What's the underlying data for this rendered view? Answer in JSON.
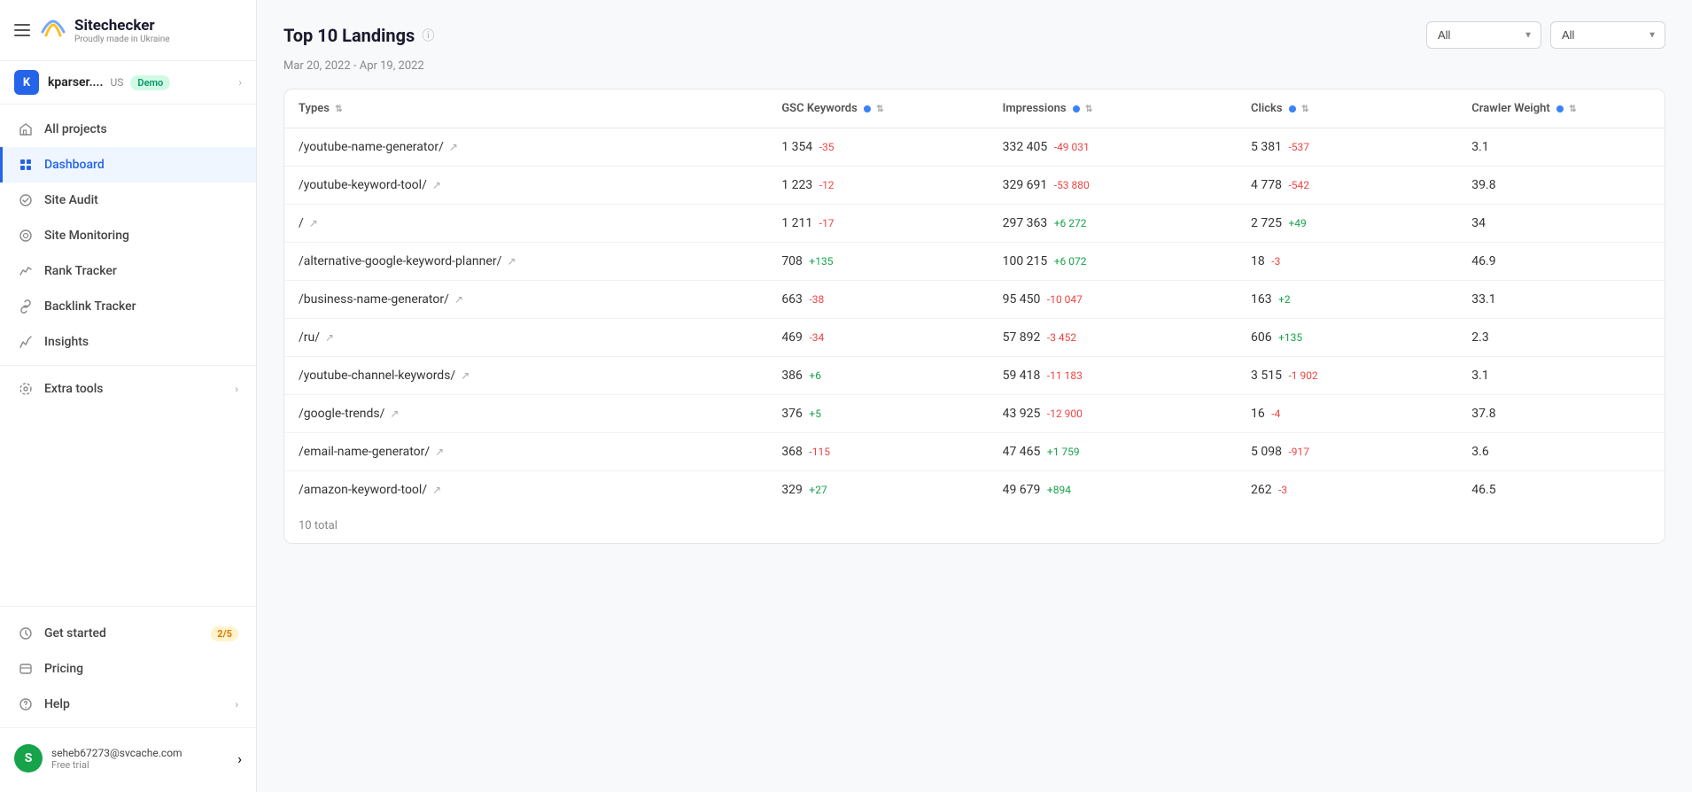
{
  "sidebar": {
    "logo": {
      "name": "Sitechecker",
      "subtitle": "Proudly made in Ukraine"
    },
    "project": {
      "initial": "K",
      "name": "kparser....",
      "country": "US",
      "badge": "Demo"
    },
    "nav": [
      {
        "id": "all-projects",
        "label": "All projects",
        "icon": "home"
      },
      {
        "id": "dashboard",
        "label": "Dashboard",
        "icon": "dashboard",
        "active": true
      },
      {
        "id": "site-audit",
        "label": "Site Audit",
        "icon": "audit"
      },
      {
        "id": "site-monitoring",
        "label": "Site Monitoring",
        "icon": "monitoring"
      },
      {
        "id": "rank-tracker",
        "label": "Rank Tracker",
        "icon": "rank"
      },
      {
        "id": "backlink-tracker",
        "label": "Backlink Tracker",
        "icon": "backlink"
      },
      {
        "id": "insights",
        "label": "Insights",
        "icon": "insights"
      }
    ],
    "extra_tools": {
      "label": "Extra tools",
      "has_chevron": true
    },
    "get_started": {
      "label": "Get started",
      "badge": "2/5"
    },
    "pricing": {
      "label": "Pricing"
    },
    "help": {
      "label": "Help",
      "has_chevron": true
    },
    "user": {
      "email": "seheb67273@svcache.com",
      "plan": "Free trial",
      "initial": "S"
    }
  },
  "main": {
    "title": "Top 10 Landings",
    "date_range": "Mar 20, 2022 - Apr 19, 2022",
    "filters": [
      {
        "id": "filter1",
        "value": "All",
        "options": [
          "All"
        ]
      },
      {
        "id": "filter2",
        "value": "All",
        "options": [
          "All"
        ]
      }
    ],
    "table": {
      "columns": [
        {
          "id": "types",
          "label": "Types"
        },
        {
          "id": "gsc_keywords",
          "label": "GSC Keywords"
        },
        {
          "id": "impressions",
          "label": "Impressions"
        },
        {
          "id": "clicks",
          "label": "Clicks"
        },
        {
          "id": "crawler_weight",
          "label": "Crawler Weight"
        }
      ],
      "rows": [
        {
          "type": "/youtube-name-generator/",
          "gsc": "1 354",
          "gsc_delta": "-35",
          "gsc_pos": false,
          "imp": "332 405",
          "imp_delta": "-49 031",
          "imp_pos": false,
          "clicks": "5 381",
          "clicks_delta": "-537",
          "clicks_pos": false,
          "crawler": "3.1"
        },
        {
          "type": "/youtube-keyword-tool/",
          "gsc": "1 223",
          "gsc_delta": "-12",
          "gsc_pos": false,
          "imp": "329 691",
          "imp_delta": "-53 880",
          "imp_pos": false,
          "clicks": "4 778",
          "clicks_delta": "-542",
          "clicks_pos": false,
          "crawler": "39.8"
        },
        {
          "type": "/",
          "gsc": "1 211",
          "gsc_delta": "-17",
          "gsc_pos": false,
          "imp": "297 363",
          "imp_delta": "+6 272",
          "imp_pos": true,
          "clicks": "2 725",
          "clicks_delta": "+49",
          "clicks_pos": true,
          "crawler": "34"
        },
        {
          "type": "/alternative-google-keyword-planner/",
          "gsc": "708",
          "gsc_delta": "+135",
          "gsc_pos": true,
          "imp": "100 215",
          "imp_delta": "+6 072",
          "imp_pos": true,
          "clicks": "18",
          "clicks_delta": "-3",
          "clicks_pos": false,
          "crawler": "46.9"
        },
        {
          "type": "/business-name-generator/",
          "gsc": "663",
          "gsc_delta": "-38",
          "gsc_pos": false,
          "imp": "95 450",
          "imp_delta": "-10 047",
          "imp_pos": false,
          "clicks": "163",
          "clicks_delta": "+2",
          "clicks_pos": true,
          "crawler": "33.1"
        },
        {
          "type": "/ru/",
          "gsc": "469",
          "gsc_delta": "-34",
          "gsc_pos": false,
          "imp": "57 892",
          "imp_delta": "-3 452",
          "imp_pos": false,
          "clicks": "606",
          "clicks_delta": "+135",
          "clicks_pos": true,
          "crawler": "2.3"
        },
        {
          "type": "/youtube-channel-keywords/",
          "gsc": "386",
          "gsc_delta": "+6",
          "gsc_pos": true,
          "imp": "59 418",
          "imp_delta": "-11 183",
          "imp_pos": false,
          "clicks": "3 515",
          "clicks_delta": "-1 902",
          "clicks_pos": false,
          "crawler": "3.1"
        },
        {
          "type": "/google-trends/",
          "gsc": "376",
          "gsc_delta": "+5",
          "gsc_pos": true,
          "imp": "43 925",
          "imp_delta": "-12 900",
          "imp_pos": false,
          "clicks": "16",
          "clicks_delta": "-4",
          "clicks_pos": false,
          "crawler": "37.8"
        },
        {
          "type": "/email-name-generator/",
          "gsc": "368",
          "gsc_delta": "-115",
          "gsc_pos": false,
          "imp": "47 465",
          "imp_delta": "+1 759",
          "imp_pos": true,
          "clicks": "5 098",
          "clicks_delta": "-917",
          "clicks_pos": false,
          "crawler": "3.6"
        },
        {
          "type": "/amazon-keyword-tool/",
          "gsc": "329",
          "gsc_delta": "+27",
          "gsc_pos": true,
          "imp": "49 679",
          "imp_delta": "+894",
          "imp_pos": true,
          "clicks": "262",
          "clicks_delta": "-3",
          "clicks_pos": false,
          "crawler": "46.5"
        }
      ],
      "footer": "10 total"
    }
  }
}
